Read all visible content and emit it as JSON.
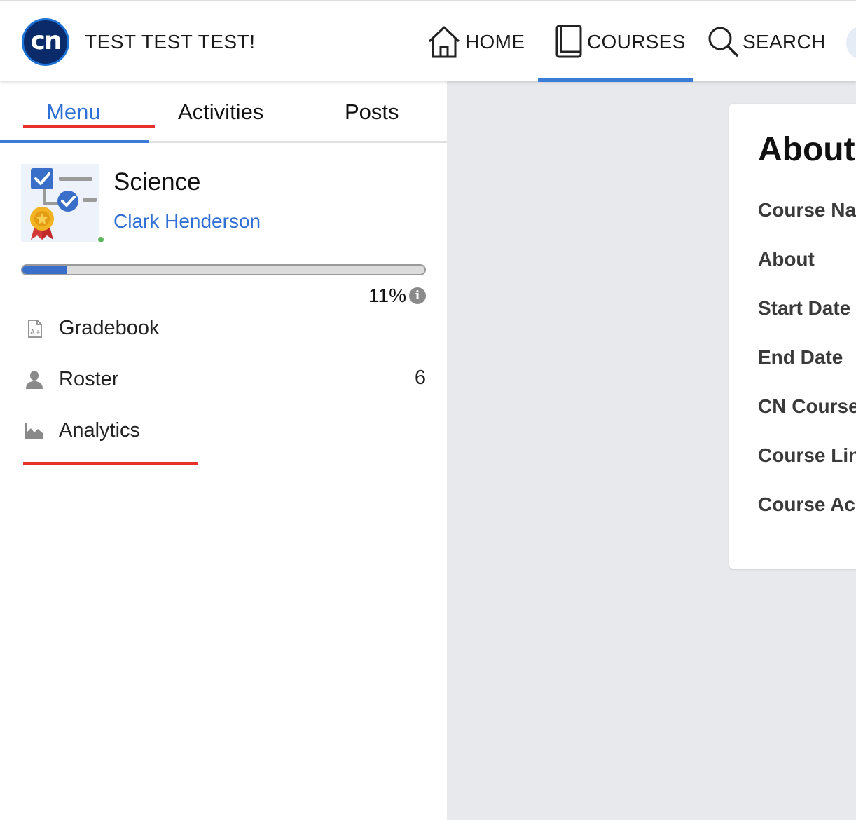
{
  "header": {
    "logo_text": "cn",
    "site_title": "TEST TEST TEST!",
    "nav": [
      {
        "label": "HOME",
        "icon": "home-icon"
      },
      {
        "label": "COURSES",
        "icon": "book-icon"
      },
      {
        "label": "SEARCH",
        "icon": "search-icon"
      }
    ],
    "active_nav": "COURSES"
  },
  "tabs": [
    {
      "label": "Menu"
    },
    {
      "label": "Activities"
    },
    {
      "label": "Posts"
    }
  ],
  "course": {
    "name": "Science",
    "teacher": "Clark Henderson",
    "progress_percent": 11,
    "progress_label": "11%",
    "info_icon": "i"
  },
  "menu": [
    {
      "label": "Gradebook",
      "icon": "gradebook-icon",
      "count": ""
    },
    {
      "label": "Roster",
      "icon": "user-icon",
      "count": "6"
    },
    {
      "label": "Analytics",
      "icon": "area-chart-icon",
      "count": ""
    }
  ],
  "about": {
    "title": "About",
    "labels": [
      "Course Na",
      "About",
      "Start Date",
      "End Date",
      "CN Course",
      "Course Lin",
      "Course Ac"
    ]
  },
  "colors": {
    "accent": "#3a7bd5",
    "link": "#2f6fd6",
    "annotation_red": "#e8312a",
    "online": "#5cb85c"
  }
}
